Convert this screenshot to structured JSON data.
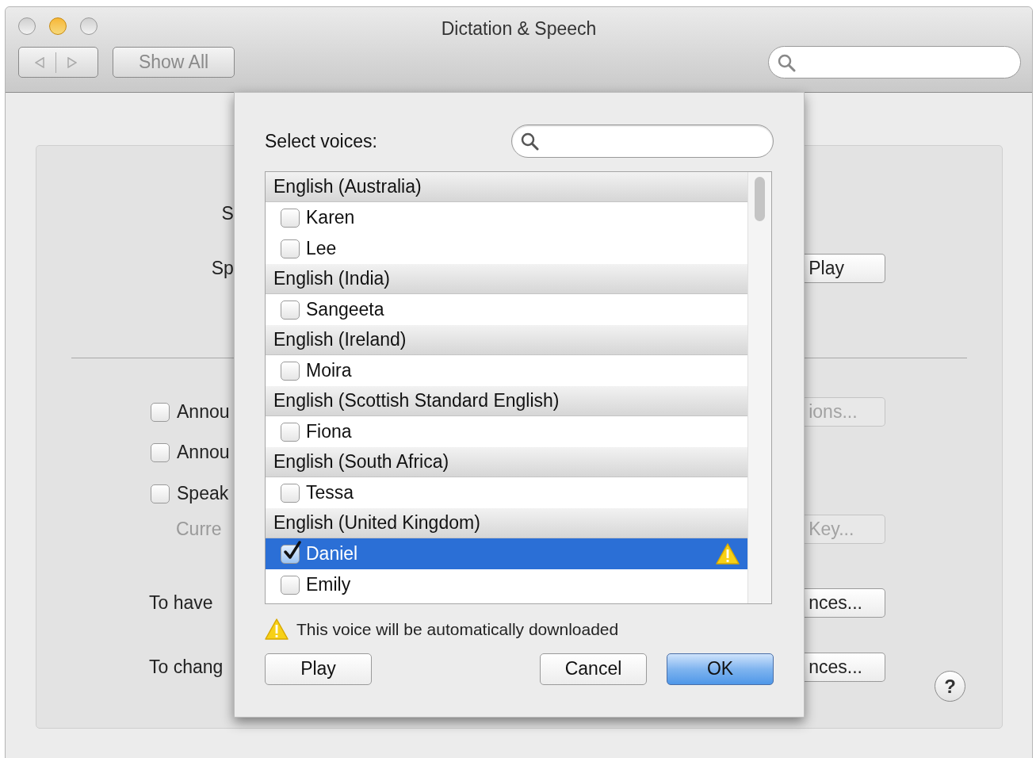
{
  "window": {
    "title": "Dictation & Speech"
  },
  "toolbar": {
    "show_all": "Show All"
  },
  "settings_rows": [
    {
      "kind": "field_label",
      "text": "S"
    },
    {
      "kind": "field_label",
      "text": "Sp",
      "button": {
        "text": "Play",
        "disabled": false
      }
    },
    {
      "kind": "separator"
    },
    {
      "kind": "checkbox",
      "text": "Annou",
      "checked": false,
      "button": {
        "text": "ions...",
        "disabled": true
      }
    },
    {
      "kind": "checkbox",
      "text": "Annou",
      "checked": false
    },
    {
      "kind": "checkbox",
      "text": "Speak",
      "checked": false
    },
    {
      "kind": "note",
      "text": "Curre",
      "button": {
        "text": "Key...",
        "disabled": true
      }
    },
    {
      "kind": "text",
      "text": "To have",
      "button": {
        "text": "nces...",
        "disabled": false
      }
    },
    {
      "kind": "text",
      "text": "To chang",
      "button": {
        "text": "nces...",
        "disabled": false
      }
    }
  ],
  "help": "?",
  "voice_sheet": {
    "title": "Select voices:",
    "groups": [
      {
        "name": "English (Australia)",
        "voices": [
          {
            "name": "Karen",
            "checked": false,
            "selected": false,
            "warning": false
          },
          {
            "name": "Lee",
            "checked": false,
            "selected": false,
            "warning": false
          }
        ]
      },
      {
        "name": "English (India)",
        "voices": [
          {
            "name": "Sangeeta",
            "checked": false,
            "selected": false,
            "warning": false
          }
        ]
      },
      {
        "name": "English (Ireland)",
        "voices": [
          {
            "name": "Moira",
            "checked": false,
            "selected": false,
            "warning": false
          }
        ]
      },
      {
        "name": "English (Scottish Standard English)",
        "voices": [
          {
            "name": "Fiona",
            "checked": false,
            "selected": false,
            "warning": false
          }
        ]
      },
      {
        "name": "English (South Africa)",
        "voices": [
          {
            "name": "Tessa",
            "checked": false,
            "selected": false,
            "warning": false
          }
        ]
      },
      {
        "name": "English (United Kingdom)",
        "voices": [
          {
            "name": "Daniel",
            "checked": true,
            "selected": true,
            "warning": true
          },
          {
            "name": "Emily",
            "checked": false,
            "selected": false,
            "warning": false
          }
        ]
      }
    ],
    "notice": "This voice will be automatically downloaded",
    "buttons": [
      {
        "label": "Play",
        "kind": "normal"
      },
      {
        "label": "Cancel",
        "kind": "normal"
      },
      {
        "label": "OK",
        "kind": "default"
      }
    ]
  }
}
